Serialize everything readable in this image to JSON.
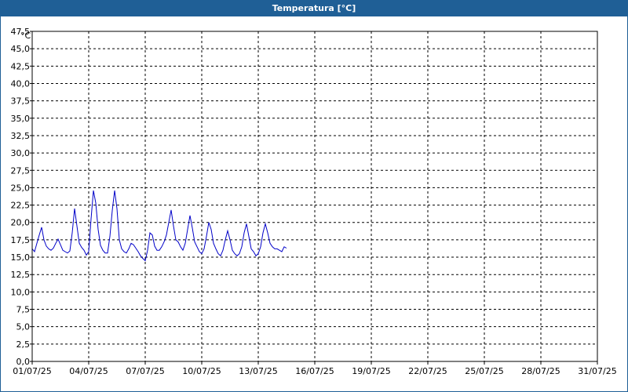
{
  "window": {
    "title": "Temperatura [°C]"
  },
  "colors": {
    "titlebar": "#1f5f96",
    "line": "#0000c8",
    "grid": "#000000",
    "background": "#ffffff"
  },
  "chart_data": {
    "type": "line",
    "title": "Temperatura [°C]",
    "yunit": "°C",
    "xlabel": "",
    "ylabel": "",
    "ylim": [
      0,
      47.5
    ],
    "xlim": [
      "2025-07-01",
      "2025-07-31"
    ],
    "grid": true,
    "legend": "none",
    "yticks": [
      "0,0",
      "2,5",
      "5,0",
      "7,5",
      "10,0",
      "12,5",
      "15,0",
      "17,5",
      "20,0",
      "22,5",
      "25,0",
      "27,5",
      "30,0",
      "32,5",
      "35,0",
      "37,5",
      "40,0",
      "42,5",
      "45,0",
      "47,5"
    ],
    "xticks": [
      "01/07/25",
      "04/07/25",
      "07/07/25",
      "10/07/25",
      "13/07/25",
      "16/07/25",
      "19/07/25",
      "22/07/25",
      "25/07/25",
      "28/07/25",
      "31/07/25"
    ],
    "series": [
      {
        "x": [
          "2025-07-01",
          "2025-07-01 03:00",
          "2025-07-01 06:00",
          "2025-07-01 09:00",
          "2025-07-01 12:00",
          "2025-07-01 15:00",
          "2025-07-01 18:00",
          "2025-07-01 21:00",
          "2025-07-02",
          "2025-07-02 03:00",
          "2025-07-02 06:00",
          "2025-07-02 09:00",
          "2025-07-02 12:00",
          "2025-07-02 15:00",
          "2025-07-02 18:00",
          "2025-07-02 21:00",
          "2025-07-03",
          "2025-07-03 03:00",
          "2025-07-03 06:00",
          "2025-07-03 09:00",
          "2025-07-03 12:00",
          "2025-07-03 15:00",
          "2025-07-03 18:00",
          "2025-07-03 21:00",
          "2025-07-04",
          "2025-07-04 03:00",
          "2025-07-04 06:00",
          "2025-07-04 09:00",
          "2025-07-04 12:00",
          "2025-07-04 15:00",
          "2025-07-04 18:00",
          "2025-07-04 21:00",
          "2025-07-05",
          "2025-07-05 03:00",
          "2025-07-05 06:00",
          "2025-07-05 09:00",
          "2025-07-05 12:00",
          "2025-07-05 15:00",
          "2025-07-05 18:00",
          "2025-07-05 21:00",
          "2025-07-06",
          "2025-07-06 03:00",
          "2025-07-06 06:00",
          "2025-07-06 09:00",
          "2025-07-06 12:00",
          "2025-07-06 15:00",
          "2025-07-06 18:00",
          "2025-07-06 21:00",
          "2025-07-07",
          "2025-07-07 03:00",
          "2025-07-07 06:00",
          "2025-07-07 09:00",
          "2025-07-07 12:00",
          "2025-07-07 15:00",
          "2025-07-07 18:00",
          "2025-07-07 21:00",
          "2025-07-08",
          "2025-07-08 03:00",
          "2025-07-08 06:00",
          "2025-07-08 09:00",
          "2025-07-08 12:00",
          "2025-07-08 15:00",
          "2025-07-08 18:00",
          "2025-07-08 21:00",
          "2025-07-09",
          "2025-07-09 03:00",
          "2025-07-09 06:00",
          "2025-07-09 09:00",
          "2025-07-09 12:00",
          "2025-07-09 15:00",
          "2025-07-09 18:00",
          "2025-07-09 21:00",
          "2025-07-10",
          "2025-07-10 03:00",
          "2025-07-10 06:00",
          "2025-07-10 09:00",
          "2025-07-10 12:00",
          "2025-07-10 15:00",
          "2025-07-10 18:00",
          "2025-07-10 21:00",
          "2025-07-11",
          "2025-07-11 03:00",
          "2025-07-11 06:00",
          "2025-07-11 09:00",
          "2025-07-11 12:00",
          "2025-07-11 15:00",
          "2025-07-11 18:00",
          "2025-07-11 21:00",
          "2025-07-12",
          "2025-07-12 03:00",
          "2025-07-12 06:00",
          "2025-07-12 09:00",
          "2025-07-12 12:00",
          "2025-07-12 15:00",
          "2025-07-12 18:00",
          "2025-07-12 21:00",
          "2025-07-13",
          "2025-07-13 03:00",
          "2025-07-13 06:00",
          "2025-07-13 09:00",
          "2025-07-13 12:00",
          "2025-07-13 15:00",
          "2025-07-13 18:00",
          "2025-07-13 21:00",
          "2025-07-14",
          "2025-07-14 03:00",
          "2025-07-14 06:00",
          "2025-07-14 09:00",
          "2025-07-14 12:00"
        ],
        "values": [
          16.2,
          15.8,
          17.0,
          18.2,
          19.3,
          17.5,
          16.6,
          16.2,
          16.0,
          16.3,
          17.0,
          17.6,
          16.8,
          16.0,
          15.8,
          15.6,
          15.9,
          18.5,
          22.0,
          19.5,
          17.0,
          16.4,
          16.0,
          15.3,
          15.8,
          20.5,
          24.6,
          22.8,
          19.0,
          16.7,
          16.0,
          15.6,
          15.6,
          18.0,
          21.7,
          24.6,
          22.0,
          17.5,
          16.2,
          15.8,
          15.6,
          16.2,
          17.0,
          16.8,
          16.3,
          15.8,
          15.2,
          14.8,
          14.5,
          16.0,
          18.5,
          18.2,
          16.6,
          16.0,
          16.0,
          16.5,
          17.2,
          18.2,
          20.0,
          21.8,
          19.5,
          17.5,
          17.2,
          16.5,
          16.0,
          17.0,
          19.0,
          21.0,
          19.2,
          17.2,
          16.5,
          15.8,
          15.5,
          16.2,
          18.0,
          20.0,
          19.0,
          17.0,
          16.2,
          15.5,
          15.2,
          16.0,
          17.5,
          18.8,
          17.5,
          16.0,
          15.5,
          15.2,
          15.5,
          16.5,
          18.5,
          19.8,
          18.0,
          16.2,
          15.8,
          15.2,
          15.5,
          16.5,
          18.5,
          19.8,
          18.5,
          17.0,
          16.5,
          16.2,
          16.2,
          16.0,
          15.8,
          16.5,
          16.3
        ]
      }
    ]
  }
}
